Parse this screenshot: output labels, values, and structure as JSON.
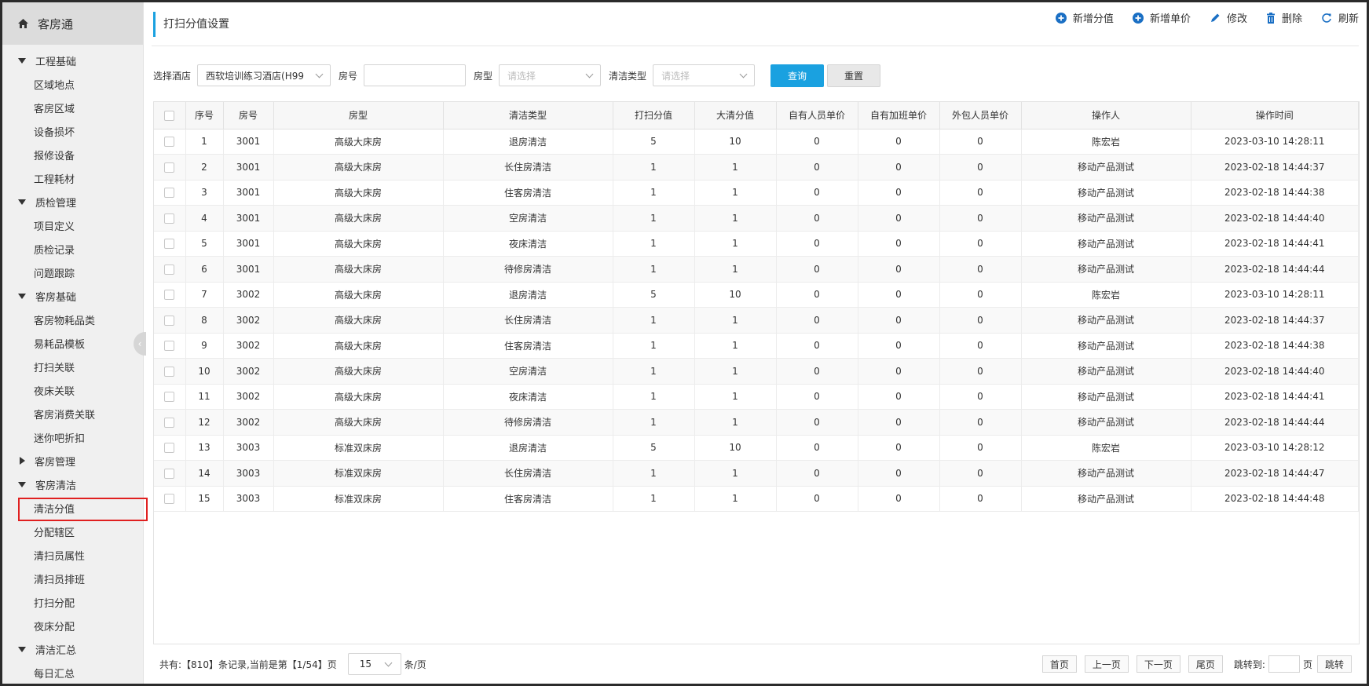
{
  "sidebar": {
    "app_title": "客房通",
    "items": [
      {
        "type": "group",
        "label": "工程基础",
        "expanded": true
      },
      {
        "type": "child",
        "label": "区域地点"
      },
      {
        "type": "child",
        "label": "客房区域"
      },
      {
        "type": "child",
        "label": "设备损坏"
      },
      {
        "type": "child",
        "label": "报修设备"
      },
      {
        "type": "child",
        "label": "工程耗材"
      },
      {
        "type": "group",
        "label": "质检管理",
        "expanded": true
      },
      {
        "type": "child",
        "label": "项目定义"
      },
      {
        "type": "child",
        "label": "质检记录"
      },
      {
        "type": "child",
        "label": "问题跟踪"
      },
      {
        "type": "group",
        "label": "客房基础",
        "expanded": true
      },
      {
        "type": "child",
        "label": "客房物耗品类"
      },
      {
        "type": "child",
        "label": "易耗品模板"
      },
      {
        "type": "child",
        "label": "打扫关联"
      },
      {
        "type": "child",
        "label": "夜床关联"
      },
      {
        "type": "child",
        "label": "客房消费关联"
      },
      {
        "type": "child",
        "label": "迷你吧折扣"
      },
      {
        "type": "group",
        "label": "客房管理",
        "expanded": false
      },
      {
        "type": "group",
        "label": "客房清洁",
        "expanded": true
      },
      {
        "type": "child",
        "label": "清洁分值",
        "selected": true
      },
      {
        "type": "child",
        "label": "分配辖区"
      },
      {
        "type": "child",
        "label": "清扫员属性"
      },
      {
        "type": "child",
        "label": "清扫员排班"
      },
      {
        "type": "child",
        "label": "打扫分配"
      },
      {
        "type": "child",
        "label": "夜床分配"
      },
      {
        "type": "group",
        "label": "清洁汇总",
        "expanded": true
      },
      {
        "type": "child",
        "label": "每日汇总"
      }
    ]
  },
  "header": {
    "title": "打扫分值设置",
    "toolbar": {
      "add_score": "新增分值",
      "add_price": "新增单价",
      "edit": "修改",
      "delete": "删除",
      "refresh": "刷新"
    }
  },
  "filter": {
    "hotel_label": "选择酒店",
    "hotel_value": "西软培训练习酒店(H99",
    "room_label": "房号",
    "room_value": "",
    "roomtype_label": "房型",
    "roomtype_placeholder": "请选择",
    "cleantype_label": "清洁类型",
    "cleantype_placeholder": "请选择",
    "query": "查询",
    "reset": "重置"
  },
  "table": {
    "columns": [
      "序号",
      "房号",
      "房型",
      "清洁类型",
      "打扫分值",
      "大清分值",
      "自有人员单价",
      "自有加班单价",
      "外包人员单价",
      "操作人",
      "操作时间"
    ],
    "rows": [
      [
        "1",
        "3001",
        "高级大床房",
        "退房清洁",
        "5",
        "10",
        "0",
        "0",
        "0",
        "陈宏岩",
        "2023-03-10 14:28:11"
      ],
      [
        "2",
        "3001",
        "高级大床房",
        "长住房清洁",
        "1",
        "1",
        "0",
        "0",
        "0",
        "移动产品测试",
        "2023-02-18 14:44:37"
      ],
      [
        "3",
        "3001",
        "高级大床房",
        "住客房清洁",
        "1",
        "1",
        "0",
        "0",
        "0",
        "移动产品测试",
        "2023-02-18 14:44:38"
      ],
      [
        "4",
        "3001",
        "高级大床房",
        "空房清洁",
        "1",
        "1",
        "0",
        "0",
        "0",
        "移动产品测试",
        "2023-02-18 14:44:40"
      ],
      [
        "5",
        "3001",
        "高级大床房",
        "夜床清洁",
        "1",
        "1",
        "0",
        "0",
        "0",
        "移动产品测试",
        "2023-02-18 14:44:41"
      ],
      [
        "6",
        "3001",
        "高级大床房",
        "待修房清洁",
        "1",
        "1",
        "0",
        "0",
        "0",
        "移动产品测试",
        "2023-02-18 14:44:44"
      ],
      [
        "7",
        "3002",
        "高级大床房",
        "退房清洁",
        "5",
        "10",
        "0",
        "0",
        "0",
        "陈宏岩",
        "2023-03-10 14:28:11"
      ],
      [
        "8",
        "3002",
        "高级大床房",
        "长住房清洁",
        "1",
        "1",
        "0",
        "0",
        "0",
        "移动产品测试",
        "2023-02-18 14:44:37"
      ],
      [
        "9",
        "3002",
        "高级大床房",
        "住客房清洁",
        "1",
        "1",
        "0",
        "0",
        "0",
        "移动产品测试",
        "2023-02-18 14:44:38"
      ],
      [
        "10",
        "3002",
        "高级大床房",
        "空房清洁",
        "1",
        "1",
        "0",
        "0",
        "0",
        "移动产品测试",
        "2023-02-18 14:44:40"
      ],
      [
        "11",
        "3002",
        "高级大床房",
        "夜床清洁",
        "1",
        "1",
        "0",
        "0",
        "0",
        "移动产品测试",
        "2023-02-18 14:44:41"
      ],
      [
        "12",
        "3002",
        "高级大床房",
        "待修房清洁",
        "1",
        "1",
        "0",
        "0",
        "0",
        "移动产品测试",
        "2023-02-18 14:44:44"
      ],
      [
        "13",
        "3003",
        "标准双床房",
        "退房清洁",
        "5",
        "10",
        "0",
        "0",
        "0",
        "陈宏岩",
        "2023-03-10 14:28:12"
      ],
      [
        "14",
        "3003",
        "标准双床房",
        "长住房清洁",
        "1",
        "1",
        "0",
        "0",
        "0",
        "移动产品测试",
        "2023-02-18 14:44:47"
      ],
      [
        "15",
        "3003",
        "标准双床房",
        "住客房清洁",
        "1",
        "1",
        "0",
        "0",
        "0",
        "移动产品测试",
        "2023-02-18 14:44:48"
      ]
    ]
  },
  "pager": {
    "info": "共有:【810】条记录,当前是第【1/54】页",
    "page_size": "15",
    "per_page": "条/页",
    "first": "首页",
    "prev": "上一页",
    "next": "下一页",
    "last": "尾页",
    "jump_label": "跳转到:",
    "page_unit": "页",
    "jump": "跳转"
  },
  "colors": {
    "accent": "#1aa1e0",
    "selected_outline": "#e02020"
  }
}
